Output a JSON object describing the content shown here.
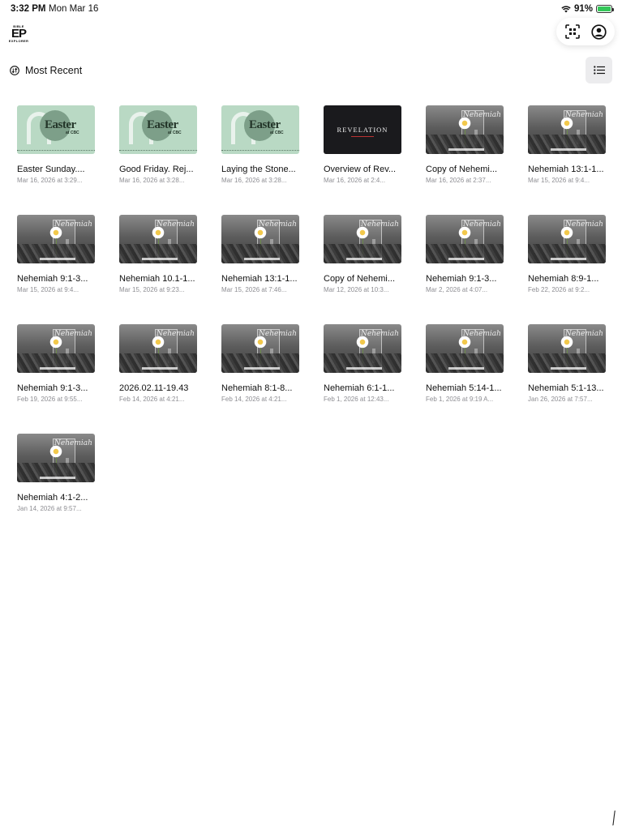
{
  "status": {
    "time": "3:32 PM",
    "date": "Mon Mar 16",
    "battery": "91%"
  },
  "sort": {
    "label": "Most Recent"
  },
  "items": [
    {
      "title": "Easter Sunday....",
      "subtitle": "Mar 16, 2026 at 3:29...",
      "thumb": "easter"
    },
    {
      "title": "Good Friday. Rej...",
      "subtitle": "Mar 16, 2026 at 3:28...",
      "thumb": "easter"
    },
    {
      "title": "Laying the Stone...",
      "subtitle": "Mar 16, 2026 at 3:28...",
      "thumb": "easter"
    },
    {
      "title": "Overview of Rev...",
      "subtitle": "Mar 16, 2026 at 2:4...",
      "thumb": "revelation"
    },
    {
      "title": "Copy of Nehemi...",
      "subtitle": "Mar 16, 2026 at 2:37...",
      "thumb": "nehemiah"
    },
    {
      "title": "Nehemiah 13:1-1...",
      "subtitle": "Mar 15, 2026 at 9:4...",
      "thumb": "nehemiah"
    },
    {
      "title": "Nehemiah 9:1-3...",
      "subtitle": "Mar 15, 2026 at 9:4...",
      "thumb": "nehemiah"
    },
    {
      "title": "Nehemiah 10.1-1...",
      "subtitle": "Mar 15, 2026 at 9:23...",
      "thumb": "nehemiah"
    },
    {
      "title": "Nehemiah 13:1-1...",
      "subtitle": "Mar 15, 2026 at 7:46...",
      "thumb": "nehemiah"
    },
    {
      "title": "Copy of Nehemi...",
      "subtitle": "Mar 12, 2026 at 10:3...",
      "thumb": "nehemiah"
    },
    {
      "title": "Nehemiah 9:1-3...",
      "subtitle": "Mar 2, 2026 at 4:07...",
      "thumb": "nehemiah"
    },
    {
      "title": "Nehemiah 8:9-1...",
      "subtitle": "Feb 22, 2026 at 9:2...",
      "thumb": "nehemiah"
    },
    {
      "title": "Nehemiah 9:1-3...",
      "subtitle": "Feb 19, 2026 at 9:55...",
      "thumb": "nehemiah"
    },
    {
      "title": "2026.02.11-19.43",
      "subtitle": "Feb 14, 2026 at 4:21...",
      "thumb": "nehemiah"
    },
    {
      "title": "Nehemiah 8:1-8...",
      "subtitle": "Feb 14, 2026 at 4:21...",
      "thumb": "nehemiah"
    },
    {
      "title": "Nehemiah 6:1-1...",
      "subtitle": "Feb 1, 2026 at 12:43...",
      "thumb": "nehemiah"
    },
    {
      "title": "Nehemiah 5:14-1...",
      "subtitle": "Feb 1, 2026 at 9:19 A...",
      "thumb": "nehemiah"
    },
    {
      "title": "Nehemiah 5:1-13...",
      "subtitle": "Jan 26, 2026 at 7:57...",
      "thumb": "nehemiah"
    },
    {
      "title": "Nehemiah 4:1-2...",
      "subtitle": "Jan 14, 2026 at 9:57...",
      "thumb": "nehemiah"
    }
  ],
  "icons": {
    "wifi": "wifi-icon",
    "battery": "battery-icon",
    "scan": "scan-icon",
    "account": "account-icon",
    "sort": "sort-icon",
    "list_view": "list-icon"
  },
  "colors": {
    "easter_bg": "#b9d9c4",
    "revelation_bg": "#1a1a1d",
    "battery_fill": "#34c759"
  }
}
